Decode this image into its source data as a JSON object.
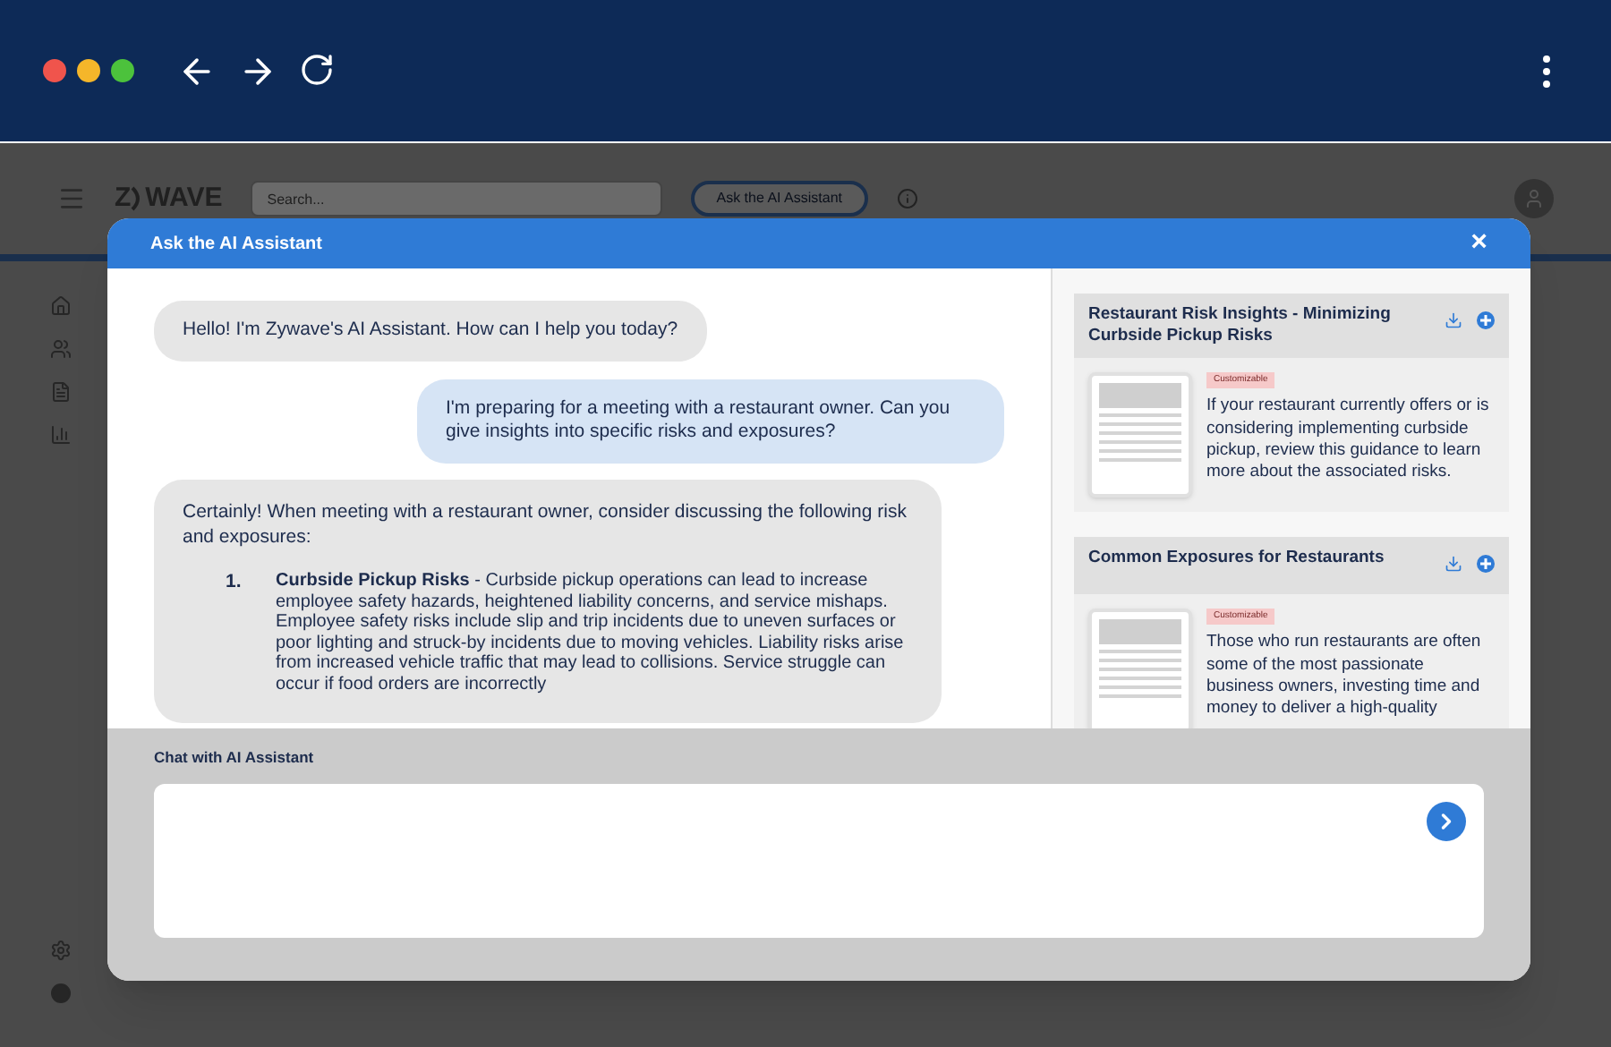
{
  "app": {
    "logo_left": "Z",
    "logo_right": "WAVE",
    "search": {
      "placeholder": "Search..."
    },
    "ai_button": "Ask the AI Assistant"
  },
  "modal": {
    "title": "Ask the AI Assistant",
    "close": "×",
    "messages": [
      {
        "kind": "assistant",
        "text": "Hello! I'm Zywave's AI Assistant. How can I help you today?"
      },
      {
        "kind": "user",
        "text": "I'm preparing for a meeting with a restaurant owner. Can you give insights into specific risks and exposures?"
      },
      {
        "kind": "assistant",
        "text": "Certainly! When meeting with a restaurant owner, consider discussing the following risk and exposures:",
        "list": [
          {
            "number": "1.",
            "text": "**Curbside Pickup Risks** - Curbside pickup operations can lead to increase employee safety hazards, heightened liability concerns, and service mishaps. Employee safety risks include slip and trip incidents due to uneven surfaces or poor lighting and struck-by incidents due to moving vehicles. Liability risks arise from increased vehicle traffic that may lead to collisions. Service struggle can occur if food orders are incorrectly"
          }
        ]
      }
    ],
    "resources": [
      {
        "title": "Restaurant Risk Insights - Minimizing Curbside Pickup Risks",
        "tag": "Customizable",
        "text": "If your restaurant currently offers or is considering implementing curbside pickup, review this guidance to learn more about the associated risks."
      },
      {
        "title": "Common Exposures for Restaurants",
        "tag": "Customizable",
        "text": "Those who run restaurants are often some of the most passionate business owners, investing time and money to deliver a high-quality"
      }
    ],
    "chat_label": "Chat with AI Assistant"
  }
}
